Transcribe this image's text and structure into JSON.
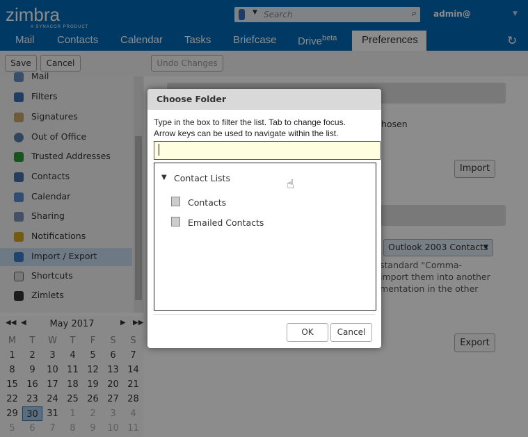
{
  "header": {
    "logo": "zimbra",
    "logo_tagline": "A SYNACOR PRODUCT",
    "search_placeholder": "Search",
    "user": "admin@"
  },
  "tabs": [
    {
      "label": "Mail"
    },
    {
      "label": "Contacts"
    },
    {
      "label": "Calendar"
    },
    {
      "label": "Tasks"
    },
    {
      "label": "Briefcase"
    },
    {
      "label": "Drive",
      "sup": "beta"
    },
    {
      "label": "Preferences",
      "selected": true
    }
  ],
  "toolbar": {
    "save": "Save",
    "cancel": "Cancel",
    "undo": "Undo Changes"
  },
  "sidebar": {
    "items": [
      {
        "label": "Mail"
      },
      {
        "label": "Filters"
      },
      {
        "label": "Signatures"
      },
      {
        "label": "Out of Office"
      },
      {
        "label": "Trusted Addresses"
      },
      {
        "label": "Contacts"
      },
      {
        "label": "Calendar"
      },
      {
        "label": "Sharing"
      },
      {
        "label": "Notifications"
      },
      {
        "label": "Import / Export",
        "selected": true
      },
      {
        "label": "Shortcuts"
      },
      {
        "label": "Zimlets"
      }
    ]
  },
  "calendar": {
    "title": "May 2017",
    "weekdays": [
      "M",
      "T",
      "W",
      "T",
      "F",
      "S",
      "S"
    ],
    "days": [
      [
        "1",
        "2",
        "3",
        "4",
        "5",
        "6",
        "7"
      ],
      [
        "8",
        "9",
        "10",
        "11",
        "12",
        "13",
        "14"
      ],
      [
        "15",
        "16",
        "17",
        "18",
        "19",
        "20",
        "21"
      ],
      [
        "22",
        "23",
        "24",
        "25",
        "26",
        "27",
        "28"
      ],
      [
        "29",
        "30",
        "31",
        "1",
        "2",
        "3",
        "4"
      ],
      [
        "5",
        "6",
        "7",
        "8",
        "9",
        "10",
        "11"
      ]
    ],
    "today": "30"
  },
  "main": {
    "chosen_text": "hosen",
    "import": "Import",
    "export": "Export",
    "format_select": "Outlook 2003 Contacts",
    "desc_lines": [
      "standard \"Comma-",
      "import them into another",
      "mentation in the other"
    ]
  },
  "dialog": {
    "title": "Choose Folder",
    "instructions_1": "Type in the box to filter the list. Tab to change focus.",
    "instructions_2": "Arrow keys can be used to navigate within the list.",
    "filter_value": "",
    "tree": {
      "group": "Contact Lists",
      "items": [
        "Contacts",
        "Emailed Contacts"
      ]
    },
    "ok": "OK",
    "cancel": "Cancel"
  },
  "colors": {
    "brand": "#0068b4",
    "selected": "#c6dcf2",
    "input_bg": "#ffffe0"
  }
}
